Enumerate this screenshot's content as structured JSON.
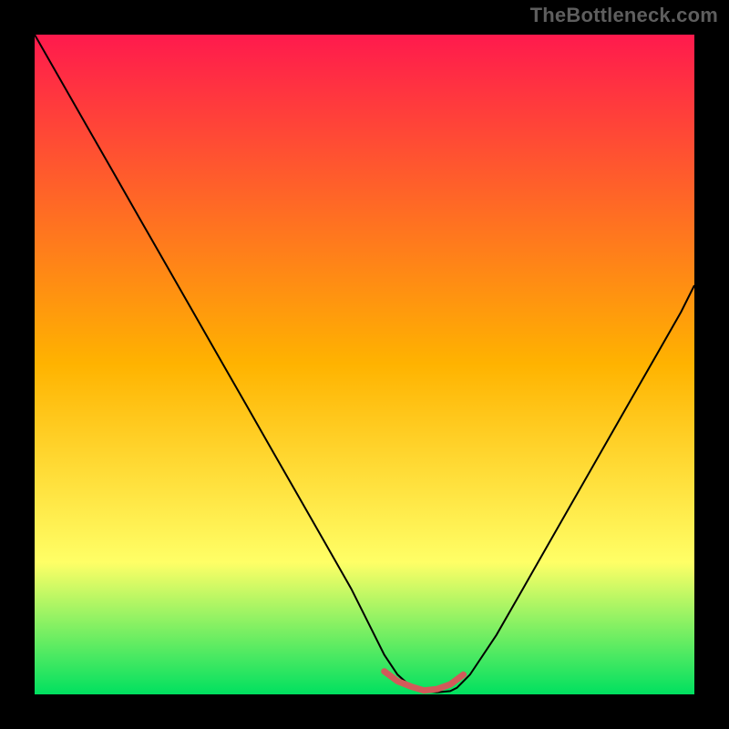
{
  "watermark": "TheBottleneck.com",
  "chart_data": {
    "type": "line",
    "title": "",
    "xlabel": "",
    "ylabel": "",
    "xlim": [
      0,
      100
    ],
    "ylim": [
      0,
      100
    ],
    "grid": false,
    "legend": false,
    "background_gradient": {
      "top_color": "#ff1a4d",
      "mid_color": "#ffb300",
      "low_color": "#ffff66",
      "bottom_color": "#00e060"
    },
    "series": [
      {
        "name": "curve",
        "x": [
          0,
          4,
          8,
          12,
          16,
          20,
          24,
          28,
          32,
          36,
          40,
          44,
          48,
          51,
          53,
          55,
          57,
          59,
          61,
          63,
          64,
          66,
          70,
          74,
          78,
          82,
          86,
          90,
          94,
          98,
          100
        ],
        "y": [
          100,
          93,
          86,
          79,
          72,
          65,
          58,
          51,
          44,
          37,
          30,
          23,
          16,
          10,
          6,
          3,
          1.2,
          0.5,
          0.3,
          0.5,
          1,
          3,
          9,
          16,
          23,
          30,
          37,
          44,
          51,
          58,
          62
        ],
        "stroke": "#000000",
        "stroke_width": 2
      },
      {
        "name": "highlight-band",
        "x": [
          53,
          55,
          57,
          59,
          61,
          63,
          65
        ],
        "y": [
          3.5,
          2,
          1.2,
          0.6,
          0.8,
          1.5,
          3
        ],
        "stroke": "#d25a5a",
        "stroke_width": 7
      }
    ],
    "annotations": []
  }
}
